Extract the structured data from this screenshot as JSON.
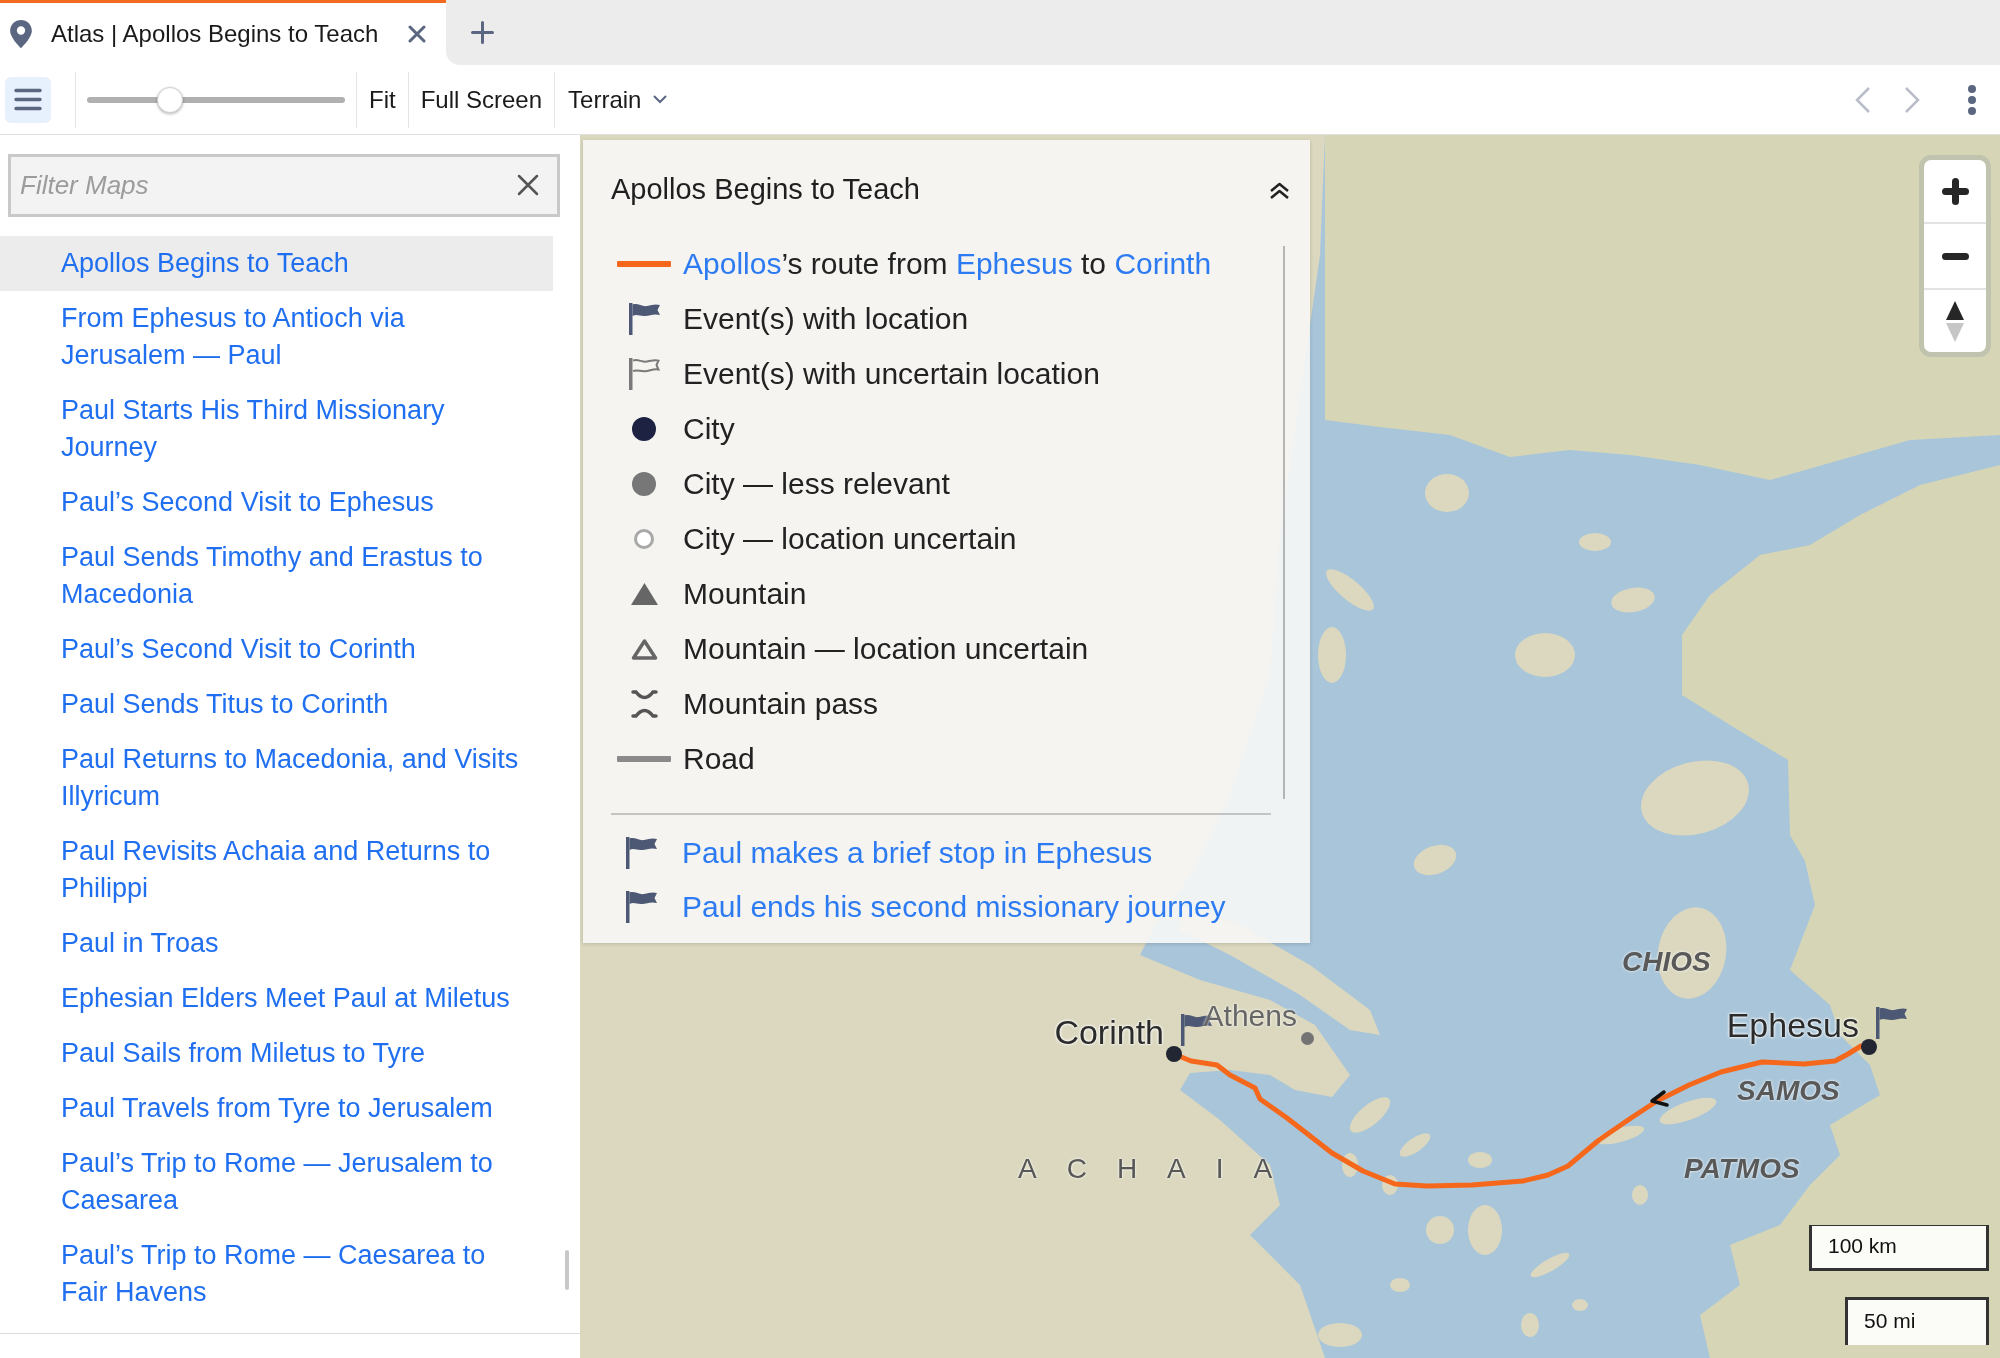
{
  "tabs": [
    {
      "title": "Atlas | Apollos Begins to Teach",
      "selected": true
    }
  ],
  "toolbar": {
    "zoom_slider": {
      "level": 0.3
    },
    "buttons": [
      "Fit",
      "Full Screen"
    ],
    "layer_menu": "Terrain"
  },
  "sidebar": {
    "filter": {
      "placeholder": "Filter Maps"
    },
    "items": [
      {
        "title": "Apollos Begins to Teach",
        "selected": true
      },
      {
        "title": "From Ephesus to Antioch via Jerusalem — Paul",
        "selected": false
      },
      {
        "title": "Paul Starts His Third Missionary Journey",
        "selected": false
      },
      {
        "title": "Paul’s Second Visit to Ephesus",
        "selected": false
      },
      {
        "title": "Paul Sends Timothy and Erastus to Macedonia",
        "selected": false
      },
      {
        "title": "Paul’s Second Visit to Corinth",
        "selected": false
      },
      {
        "title": "Paul Sends Titus to Corinth",
        "selected": false
      },
      {
        "title": "Paul Returns to Macedonia, and Visits Illyricum",
        "selected": false
      },
      {
        "title": "Paul Revisits Achaia and Returns to Philippi",
        "selected": false
      },
      {
        "title": "Paul in Troas",
        "selected": false
      },
      {
        "title": "Ephesian Elders Meet Paul at Miletus",
        "selected": false
      },
      {
        "title": "Paul Sails from Miletus to Tyre",
        "selected": false
      },
      {
        "title": "Paul Travels from Tyre to Jerusalem",
        "selected": false
      },
      {
        "title": "Paul’s Trip to Rome — Jerusalem to Caesarea",
        "selected": false
      },
      {
        "title": "Paul’s Trip to Rome — Caesarea to Fair Havens",
        "selected": false
      }
    ]
  },
  "legend": {
    "title": "Apollos Begins to Teach",
    "items": [
      {
        "kind": "route",
        "parts": [
          {
            "text": "Apollos",
            "link": true
          },
          {
            "text": "’s route from ",
            "link": false
          },
          {
            "text": "Ephesus",
            "link": true
          },
          {
            "text": " to ",
            "link": false
          },
          {
            "text": "Corinth",
            "link": true
          }
        ]
      },
      {
        "kind": "flag",
        "label": "Event(s) with location"
      },
      {
        "kind": "flag-uncertain",
        "label": "Event(s) with uncertain location"
      },
      {
        "kind": "city",
        "label": "City"
      },
      {
        "kind": "city-minor",
        "label": "City — less relevant"
      },
      {
        "kind": "city-uncertain",
        "label": "City — location uncertain"
      },
      {
        "kind": "mountain",
        "label": "Mountain"
      },
      {
        "kind": "mountain-uncertain",
        "label": "Mountain — location uncertain"
      },
      {
        "kind": "pass",
        "label": "Mountain pass"
      },
      {
        "kind": "road",
        "label": "Road"
      }
    ],
    "events": [
      "Paul makes a brief stop in Ephesus",
      "Paul ends his second missionary journey"
    ]
  },
  "map": {
    "places": [
      {
        "name": "Corinth",
        "kind": "city",
        "flag": true
      },
      {
        "name": "Athens",
        "kind": "city-minor",
        "flag": false
      },
      {
        "name": "Ephesus",
        "kind": "city",
        "flag": true
      }
    ],
    "labels": [
      {
        "text": "CHIOS",
        "kind": "island"
      },
      {
        "text": "SAMOS",
        "kind": "island"
      },
      {
        "text": "PATMOS",
        "kind": "island"
      },
      {
        "text": "ACHAIA",
        "kind": "region"
      }
    ],
    "scale": [
      "100 km",
      "50 mi"
    ]
  }
}
